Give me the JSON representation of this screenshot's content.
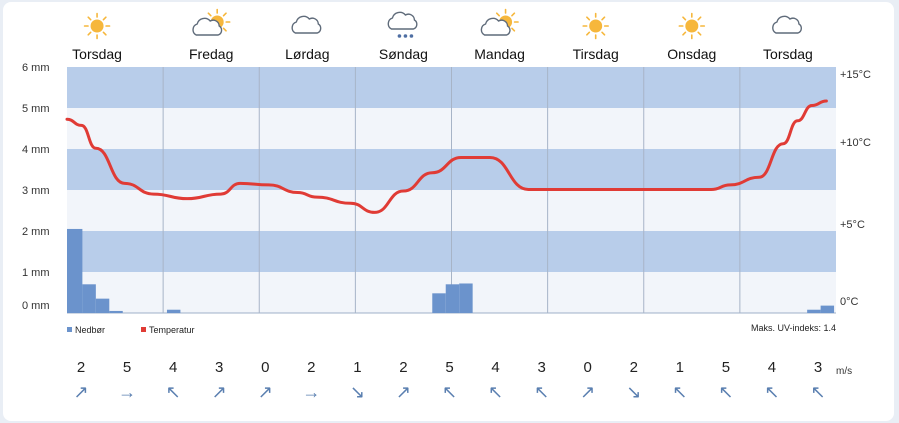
{
  "days": [
    {
      "name": "Torsdag",
      "icon": "sun-icon"
    },
    {
      "name": "Fredag",
      "icon": "partly-cloudy-icon"
    },
    {
      "name": "Lørdag",
      "icon": "cloud-icon"
    },
    {
      "name": "Søndag",
      "icon": "snow-cloud-icon"
    },
    {
      "name": "Mandag",
      "icon": "partly-cloudy-icon"
    },
    {
      "name": "Tirsdag",
      "icon": "sun-icon"
    },
    {
      "name": "Onsdag",
      "icon": "sun-icon"
    },
    {
      "name": "Torsdag",
      "icon": "cloud-icon"
    }
  ],
  "legend": {
    "precip": "Nedbør",
    "temp": "Temperatur",
    "uv": "Maks. UV-indeks: 1.4"
  },
  "wind": {
    "unit": "m/s",
    "speeds": [
      "2",
      "5",
      "4",
      "3",
      "0",
      "2",
      "1",
      "2",
      "5",
      "4",
      "3",
      "0",
      "2",
      "1",
      "5",
      "4",
      "3"
    ],
    "arrows": [
      "↗",
      "→",
      "↖",
      "↗",
      "↗",
      "→",
      "↘",
      "↗",
      "↖",
      "↖",
      "↖",
      "↗",
      "↘",
      "↖",
      "↖",
      "↖",
      "↖"
    ]
  },
  "colors": {
    "band": "#b8cdea",
    "band_alt": "#f2f5fa",
    "temp_line": "#e03b35",
    "precip_bar": "#6b93cc",
    "arrow": "#5a7fb0",
    "sun": "#f6b73c"
  },
  "chart_data": {
    "type": "line",
    "left_axis": {
      "label": "",
      "ticks": [
        "0 mm",
        "1 mm",
        "2 mm",
        "3 mm",
        "4 mm",
        "5 mm",
        "6 mm"
      ],
      "range": [
        0,
        6
      ]
    },
    "right_axis": {
      "label": "",
      "ticks": [
        "0°C",
        "+5°C",
        "+10°C",
        "+15°C"
      ],
      "range": [
        0,
        15
      ]
    },
    "x_categories": [
      "Torsdag",
      "Fredag",
      "Lørdag",
      "Søndag",
      "Mandag",
      "Tirsdag",
      "Onsdag",
      "Torsdag"
    ],
    "series": [
      {
        "name": "Temperatur",
        "kind": "line",
        "axis": "right",
        "x": [
          0,
          0.15,
          0.3,
          0.6,
          0.9,
          1.25,
          1.6,
          1.8,
          2.1,
          2.4,
          2.6,
          2.95,
          3.2,
          3.5,
          3.8,
          4.1,
          4.4,
          4.8,
          5.2,
          5.6,
          6.0,
          6.4,
          6.7,
          6.9,
          7.2,
          7.45,
          7.6,
          7.75,
          7.9
        ],
        "values": [
          12.1,
          11.7,
          10.2,
          7.9,
          7.2,
          6.9,
          7.2,
          7.9,
          7.8,
          7.3,
          7.0,
          6.6,
          6.0,
          7.4,
          8.6,
          9.6,
          9.6,
          7.5,
          7.5,
          7.5,
          7.5,
          7.5,
          7.5,
          7.8,
          8.3,
          10.5,
          12.0,
          13.0,
          13.3
        ]
      },
      {
        "name": "Nedbør",
        "kind": "bar",
        "axis": "left",
        "bars": [
          {
            "x": 0.0,
            "w": 0.16,
            "value": 2.05
          },
          {
            "x": 0.16,
            "w": 0.14,
            "value": 0.7
          },
          {
            "x": 0.3,
            "w": 0.14,
            "value": 0.35
          },
          {
            "x": 0.44,
            "w": 0.14,
            "value": 0.05
          },
          {
            "x": 1.04,
            "w": 0.14,
            "value": 0.08
          },
          {
            "x": 3.8,
            "w": 0.14,
            "value": 0.48
          },
          {
            "x": 3.94,
            "w": 0.14,
            "value": 0.7
          },
          {
            "x": 4.08,
            "w": 0.14,
            "value": 0.72
          },
          {
            "x": 7.7,
            "w": 0.14,
            "value": 0.08
          },
          {
            "x": 7.84,
            "w": 0.14,
            "value": 0.18
          }
        ]
      }
    ],
    "grid": true,
    "legend_position": "bottom-left"
  }
}
